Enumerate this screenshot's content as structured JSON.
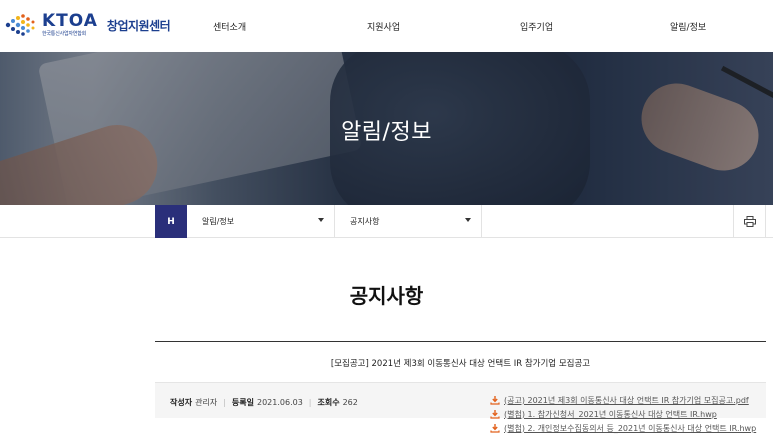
{
  "logo": {
    "brand": "KTOA",
    "sub": "한국통신사업자연합회",
    "center": "창업지원센터"
  },
  "gnb": [
    "센터소개",
    "지원사업",
    "입주기업",
    "알림/정보"
  ],
  "banner": {
    "title": "알림/정보"
  },
  "location": {
    "home": "H",
    "depth1": "알림/정보",
    "depth2": "공지사항"
  },
  "page": {
    "title": "공지사항"
  },
  "post": {
    "title": "[모집공고] 2021년 제3회 이동통신사 대상 언택트 IR 참가기업 모집공고",
    "author_label": "작성자",
    "author": "관리자",
    "date_label": "등록일",
    "date": "2021.06.03",
    "views_label": "조회수",
    "views": "262",
    "files": [
      "(공고) 2021년 제3회 이동통신사 대상 언택트 IR 참가기업 모집공고.pdf",
      "(별첨) 1. 참가신청서_2021년 이동통신사 대상 언택트 IR.hwp",
      "(별첨) 2. 개인정보수집동의서 등_2021년 이동통신사 대상 언택트 IR.hwp"
    ]
  },
  "colors": {
    "brand": "#1c3f8f",
    "home_btn": "#2a2f7a",
    "download_icon": "#e2611c"
  },
  "icons": {
    "print": "print-icon",
    "download": "download-icon",
    "dropdown": "chevron-down-icon"
  }
}
